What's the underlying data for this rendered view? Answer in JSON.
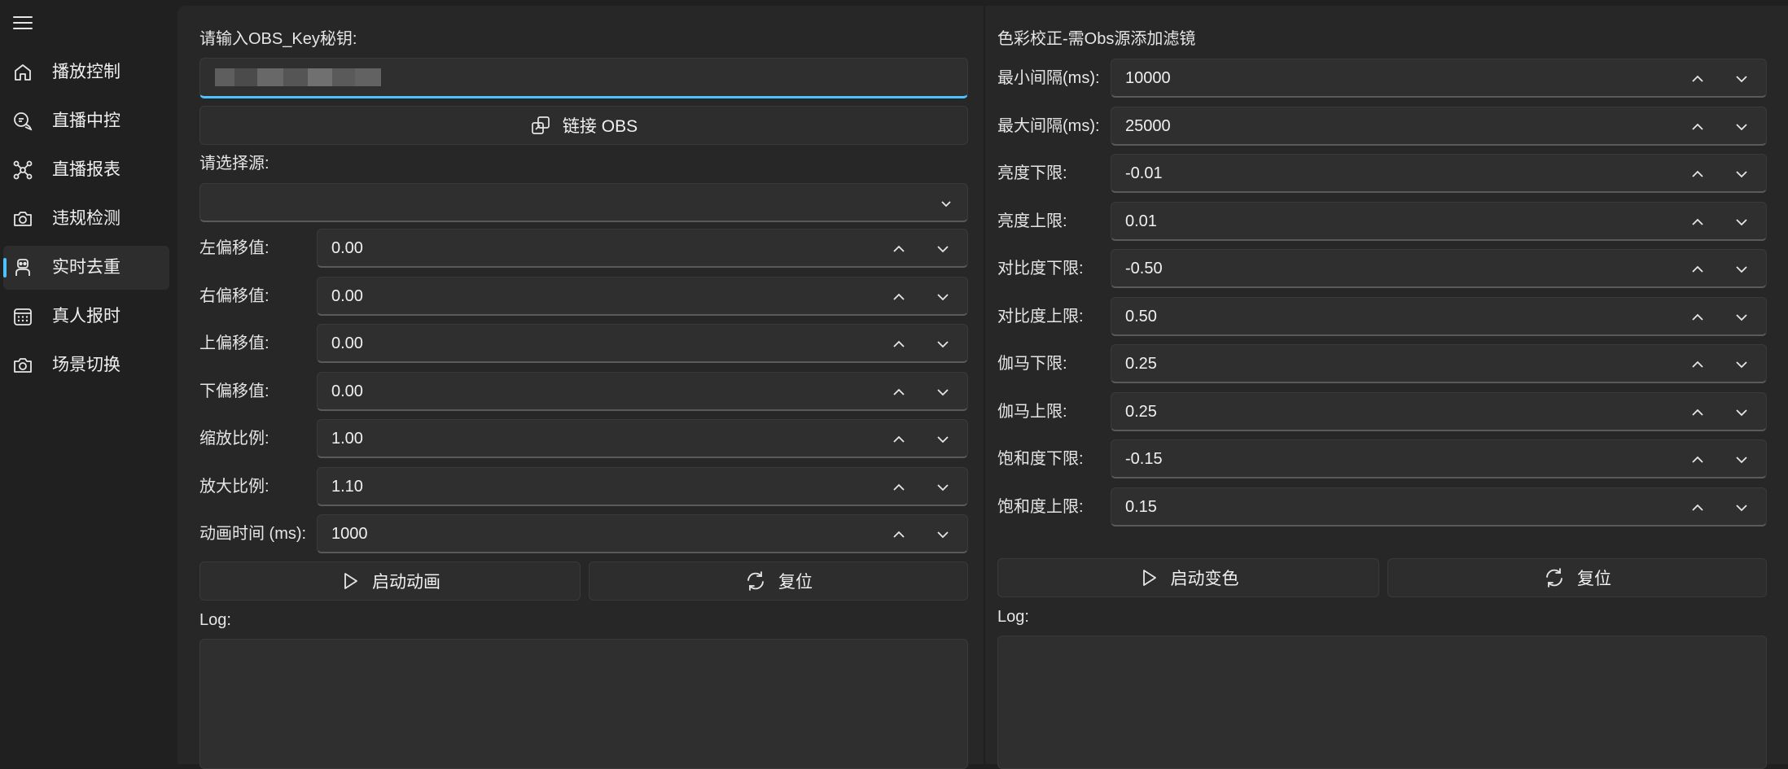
{
  "sidebar": {
    "items": [
      {
        "label": "播放控制",
        "icon": "home-icon"
      },
      {
        "label": "直播中控",
        "icon": "chat-icon"
      },
      {
        "label": "直播报表",
        "icon": "network-icon"
      },
      {
        "label": "违规检测",
        "icon": "camera-icon"
      },
      {
        "label": "实时去重",
        "icon": "robot-icon"
      },
      {
        "label": "真人报时",
        "icon": "calendar-icon"
      },
      {
        "label": "场景切换",
        "icon": "camera-icon"
      }
    ],
    "active_index": 4
  },
  "left": {
    "key_label": "请输入OBS_Key秘钥:",
    "key_value": "",
    "connect_label": "链接 OBS",
    "source_label": "请选择源:",
    "source_value": "",
    "fields": [
      {
        "label": "左偏移值:",
        "value": "0.00"
      },
      {
        "label": "右偏移值:",
        "value": "0.00"
      },
      {
        "label": "上偏移值:",
        "value": "0.00"
      },
      {
        "label": "下偏移值:",
        "value": "0.00"
      },
      {
        "label": "缩放比例:",
        "value": "1.00"
      },
      {
        "label": "放大比例:",
        "value": "1.10"
      },
      {
        "label": "动画时间 (ms):",
        "value": "1000"
      }
    ],
    "start_label": "启动动画",
    "reset_label": "复位",
    "log_label": "Log:",
    "log_text": ""
  },
  "right": {
    "title": "色彩校正-需Obs源添加滤镜",
    "fields": [
      {
        "label": "最小间隔(ms):",
        "value": "10000"
      },
      {
        "label": "最大间隔(ms):",
        "value": "25000"
      },
      {
        "label": "亮度下限:",
        "value": "-0.01"
      },
      {
        "label": "亮度上限:",
        "value": "0.01"
      },
      {
        "label": "对比度下限:",
        "value": "-0.50"
      },
      {
        "label": "对比度上限:",
        "value": "0.50"
      },
      {
        "label": "伽马下限:",
        "value": "0.25"
      },
      {
        "label": "伽马上限:",
        "value": "0.25"
      },
      {
        "label": "饱和度下限:",
        "value": "-0.15"
      },
      {
        "label": "饱和度上限:",
        "value": "0.15"
      }
    ],
    "start_label": "启动变色",
    "reset_label": "复位",
    "log_label": "Log:",
    "log_text": ""
  },
  "colors": {
    "accent": "#4cc2ff",
    "background": "#202020",
    "panel": "#272727"
  }
}
